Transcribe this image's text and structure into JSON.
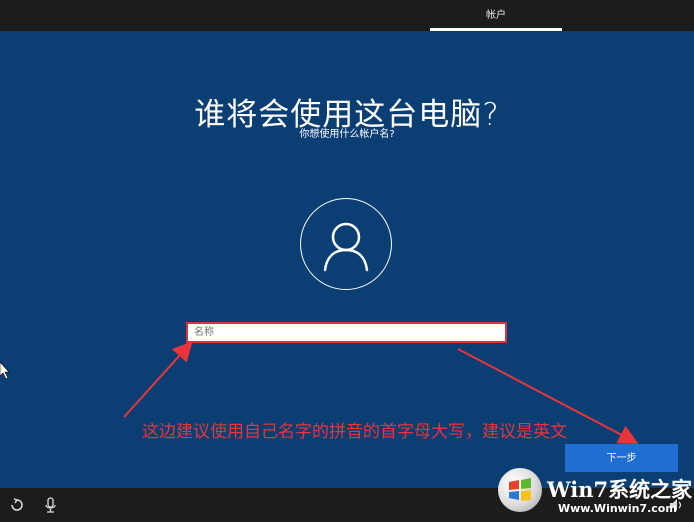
{
  "header": {
    "tab_label": "帐户"
  },
  "main": {
    "title": "谁将会使用这台电脑?",
    "subtitle": "你想使用什么帐户名?",
    "name_placeholder": "名称",
    "next_label": "下一步"
  },
  "annotation": {
    "text": "这边建议使用自己名字的拼音的首字母大写，建议是英文"
  },
  "watermark": {
    "brand": "Win7系统之家",
    "url": "Www.Winwin7.com"
  },
  "colors": {
    "background": "#0b3f74",
    "accent": "#1f6fd0",
    "highlight": "#e0303a"
  },
  "icons": {
    "bottom_left": [
      "ease-of-access-icon",
      "microphone-icon"
    ],
    "bottom_right": [
      "volume-icon"
    ],
    "cursor": "mouse-pointer-icon"
  }
}
